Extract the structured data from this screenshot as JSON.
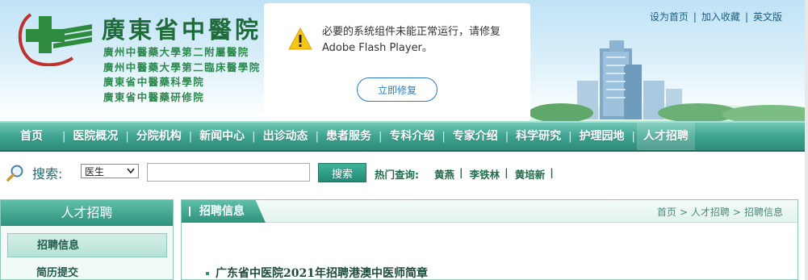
{
  "header": {
    "site_title": "廣東省中醫院",
    "sub_names": [
      "廣州中醫藥大學第二附屬醫院",
      "廣州中醫藥大學第二臨床醫學院",
      "廣東省中醫藥科學院",
      "廣東省中醫藥研修院"
    ],
    "top_links": [
      "设为首页",
      "加入收藏",
      "英文版"
    ]
  },
  "flash_popup": {
    "message": "必要的系统组件未能正常运行，请修复 Adobe Flash Player。",
    "button_label": "立即修复"
  },
  "nav": {
    "items": [
      "首页",
      "医院概况",
      "分院机构",
      "新闻中心",
      "出诊动态",
      "患者服务",
      "专科介绍",
      "专家介绍",
      "科学研究",
      "护理园地",
      "人才招聘"
    ],
    "active": "人才招聘"
  },
  "search": {
    "label": "搜索:",
    "select_value": "医生",
    "input_value": "",
    "button_label": "搜索",
    "hot_label": "热门查询:",
    "hot_items": [
      "黄燕",
      "李铁林",
      "黄培新"
    ]
  },
  "sidebar": {
    "title": "人才招聘",
    "items": [
      "招聘信息",
      "简历提交"
    ],
    "active": "招聘信息"
  },
  "main": {
    "tab_label": "招聘信息",
    "breadcrumb": [
      "首页",
      "人才招聘",
      "招聘信息"
    ],
    "articles": [
      "广东省中医院2021年招聘港澳中医师简章"
    ]
  },
  "colors": {
    "primary_green": "#2f927c",
    "title_green": "#1f6b3a",
    "link_blue": "#2a7bbf"
  }
}
